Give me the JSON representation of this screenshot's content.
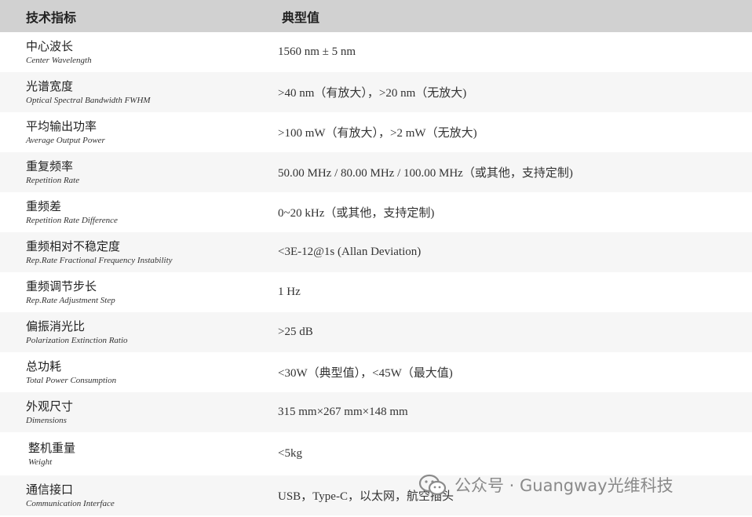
{
  "header": {
    "param_label": "技术指标",
    "value_label": "典型值"
  },
  "rows": [
    {
      "zh": "中心波长",
      "en": "Center Wavelength",
      "value": "1560 nm ± 5 nm"
    },
    {
      "zh": "光谱宽度",
      "en": "Optical Spectral Bandwidth FWHM",
      "value": ">40 nm（有放大），>20 nm（无放大)"
    },
    {
      "zh": "平均输出功率",
      "en": "Average Output Power",
      "value": ">100 mW（有放大），>2 mW（无放大)"
    },
    {
      "zh": "重复频率",
      "en": "Repetition Rate",
      "value": "50.00 MHz / 80.00 MHz / 100.00 MHz（或其他，支持定制)"
    },
    {
      "zh": "重频差",
      "en": "Repetition Rate Difference",
      "value": "0~20 kHz（或其他，支持定制)"
    },
    {
      "zh": "重频相对不稳定度",
      "en": "Rep.Rate Fractional Frequency Instability",
      "value": "<3E-12@1s (Allan Deviation)"
    },
    {
      "zh": "重频调节步长",
      "en": "Rep.Rate Adjustment Step",
      "value": "1 Hz"
    },
    {
      "zh": "偏振消光比",
      "en": "Polarization Extinction Ratio",
      "value": ">25 dB"
    },
    {
      "zh": "总功耗",
      "en": "Total Power Consumption",
      "value": "<30W（典型值），<45W（最大值)"
    },
    {
      "zh": "外观尺寸",
      "en": "Dimensions",
      "value": "315 mm×267 mm×148 mm"
    },
    {
      "zh": "整机重量",
      "en": "Weight",
      "value": "<5kg"
    },
    {
      "zh": "通信接口",
      "en": "Communication Interface",
      "value": "USB，Type-C，以太网，航空插头"
    }
  ],
  "watermark": {
    "text": "公众号 · Guangway光维科技",
    "icon": "wechat-icon"
  }
}
